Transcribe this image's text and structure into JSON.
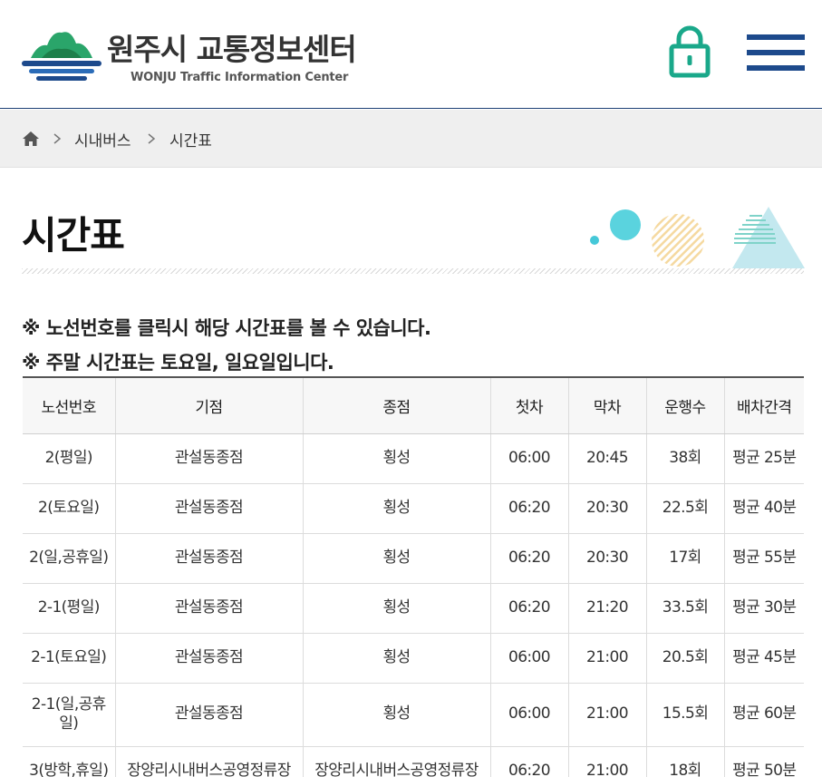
{
  "header": {
    "title": "원주시 교통정보센터",
    "subtitle": "WONJU Traffic Information Center",
    "lock_icon": "lock-icon",
    "menu_icon": "hamburger-menu-icon",
    "accent_color": "#1d4a8c",
    "lock_color": "#1aa88a"
  },
  "breadcrumb": {
    "home_icon": "home-icon",
    "items": [
      "시내버스",
      "시간표"
    ]
  },
  "page": {
    "title": "시간표"
  },
  "notices": [
    "※ 노선번호를 클릭시 해당 시간표를 볼 수 있습니다.",
    "※ 주말 시간표는 토요일, 일요일입니다."
  ],
  "table": {
    "headers": [
      "노선번호",
      "기점",
      "종점",
      "첫차",
      "막차",
      "운행수",
      "배차간격"
    ],
    "rows": [
      [
        "2(평일)",
        "관설동종점",
        "횡성",
        "06:00",
        "20:45",
        "38회",
        "평균 25분"
      ],
      [
        "2(토요일)",
        "관설동종점",
        "횡성",
        "06:20",
        "20:30",
        "22.5회",
        "평균 40분"
      ],
      [
        "2(일,공휴일)",
        "관설동종점",
        "횡성",
        "06:20",
        "20:30",
        "17회",
        "평균 55분"
      ],
      [
        "2-1(평일)",
        "관설동종점",
        "횡성",
        "06:20",
        "21:20",
        "33.5회",
        "평균 30분"
      ],
      [
        "2-1(토요일)",
        "관설동종점",
        "횡성",
        "06:00",
        "21:00",
        "20.5회",
        "평균 45분"
      ],
      [
        "2-1(일,공휴일)",
        "관설동종점",
        "횡성",
        "06:00",
        "21:00",
        "15.5회",
        "평균 60분"
      ],
      [
        "3(방학,휴일)",
        "장양리시내버스공영정류장",
        "장양리시내버스공영정류장",
        "06:20",
        "21:00",
        "18회",
        "평균 50분"
      ]
    ]
  }
}
